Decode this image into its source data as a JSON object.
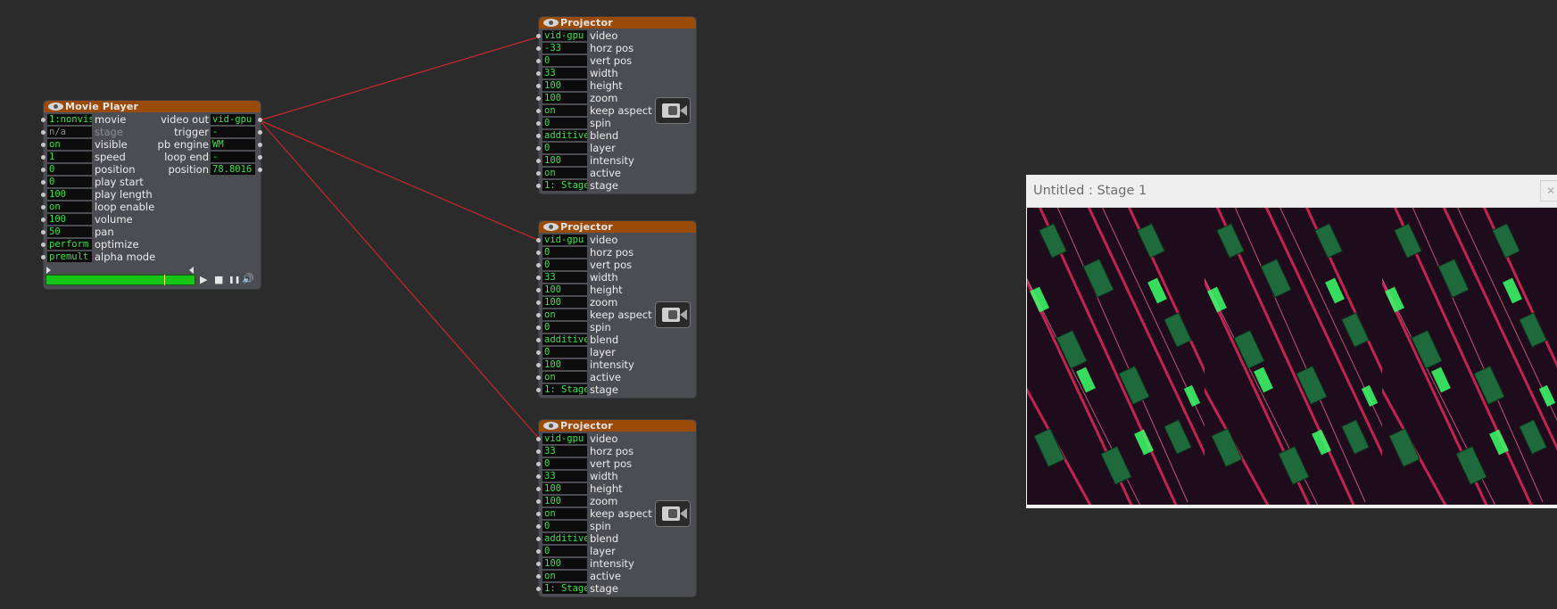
{
  "movie_player": {
    "title": "Movie Player",
    "inputs": [
      {
        "value": "1:nonvis",
        "label": "movie"
      },
      {
        "value": "n/a",
        "label": "stage",
        "dim": true
      },
      {
        "value": "on",
        "label": "visible"
      },
      {
        "value": "1",
        "label": "speed"
      },
      {
        "value": "0",
        "label": "position"
      },
      {
        "value": "0",
        "label": "play start"
      },
      {
        "value": "100",
        "label": "play length"
      },
      {
        "value": "on",
        "label": "loop enable"
      },
      {
        "value": "100",
        "label": "volume"
      },
      {
        "value": "50",
        "label": "pan"
      },
      {
        "value": "perform",
        "label": "optimize"
      },
      {
        "value": "premult",
        "label": "alpha mode"
      }
    ],
    "outputs": [
      {
        "label": "video out",
        "value": "vid-gpu"
      },
      {
        "label": "trigger",
        "value": "-"
      },
      {
        "label": "pb engine",
        "value": "WM"
      },
      {
        "label": "loop end",
        "value": "-"
      },
      {
        "label": "position",
        "value": "78.8016"
      }
    ],
    "playhead_fraction": 0.79,
    "transport": {
      "play": "▶",
      "stop": "■",
      "pause": "❚❚",
      "sound": "🔊"
    }
  },
  "projectors": [
    {
      "title": "Projector",
      "inputs": [
        {
          "value": "vid-gpu",
          "label": "video"
        },
        {
          "value": "-33",
          "label": "horz pos"
        },
        {
          "value": "0",
          "label": "vert pos"
        },
        {
          "value": "33",
          "label": "width"
        },
        {
          "value": "100",
          "label": "height"
        },
        {
          "value": "100",
          "label": "zoom"
        },
        {
          "value": "on",
          "label": "keep aspect"
        },
        {
          "value": "0",
          "label": "spin"
        },
        {
          "value": "additive",
          "label": "blend"
        },
        {
          "value": "0",
          "label": "layer"
        },
        {
          "value": "100",
          "label": "intensity"
        },
        {
          "value": "on",
          "label": "active"
        },
        {
          "value": "1: Stage",
          "label": "stage"
        }
      ]
    },
    {
      "title": "Projector",
      "inputs": [
        {
          "value": "vid-gpu",
          "label": "video"
        },
        {
          "value": "0",
          "label": "horz pos"
        },
        {
          "value": "0",
          "label": "vert pos"
        },
        {
          "value": "33",
          "label": "width"
        },
        {
          "value": "100",
          "label": "height"
        },
        {
          "value": "100",
          "label": "zoom"
        },
        {
          "value": "on",
          "label": "keep aspect"
        },
        {
          "value": "0",
          "label": "spin"
        },
        {
          "value": "additive",
          "label": "blend"
        },
        {
          "value": "0",
          "label": "layer"
        },
        {
          "value": "100",
          "label": "intensity"
        },
        {
          "value": "on",
          "label": "active"
        },
        {
          "value": "1: Stage",
          "label": "stage"
        }
      ]
    },
    {
      "title": "Projector",
      "inputs": [
        {
          "value": "vid-gpu",
          "label": "video"
        },
        {
          "value": "33",
          "label": "horz pos"
        },
        {
          "value": "0",
          "label": "vert pos"
        },
        {
          "value": "33",
          "label": "width"
        },
        {
          "value": "100",
          "label": "height"
        },
        {
          "value": "100",
          "label": "zoom"
        },
        {
          "value": "on",
          "label": "keep aspect"
        },
        {
          "value": "0",
          "label": "spin"
        },
        {
          "value": "additive",
          "label": "blend"
        },
        {
          "value": "0",
          "label": "layer"
        },
        {
          "value": "100",
          "label": "intensity"
        },
        {
          "value": "on",
          "label": "active"
        },
        {
          "value": "1: Stage",
          "label": "stage"
        }
      ]
    }
  ],
  "stage_window": {
    "title": "Untitled : Stage 1",
    "close_glyph": "✕"
  },
  "colors": {
    "background": "#2b2b2b",
    "actor_body": "#4c4d52",
    "actor_title": "#9a4b08",
    "value_text": "#3ae24a",
    "wire": "#c0282a"
  }
}
